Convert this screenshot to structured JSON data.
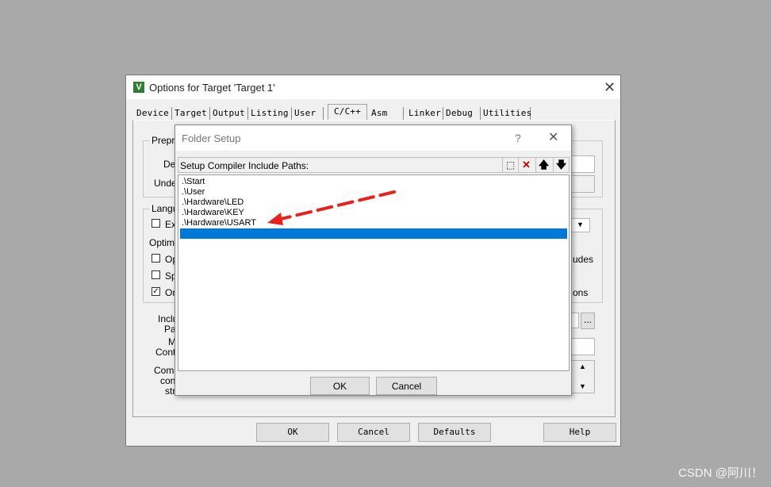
{
  "main_window": {
    "title": "Options for Target 'Target 1'",
    "close_glyph": "✕",
    "logo_glyph": "V",
    "tabs": [
      {
        "label": "Device"
      },
      {
        "label": "Target"
      },
      {
        "label": "Output"
      },
      {
        "label": "Listing"
      },
      {
        "label": "User"
      },
      {
        "label": "C/C++"
      },
      {
        "label": "Asm"
      },
      {
        "label": "Linker"
      },
      {
        "label": "Debug"
      },
      {
        "label": "Utilities"
      }
    ],
    "active_tab": "C/C++",
    "preprocessor_group_label": "Prepro",
    "define_label": "Def",
    "undefine_label": "Undef",
    "language_group_label": "Langu",
    "execute_label": "Ex",
    "optimization_label": "Optimiz",
    "opt1_label": "Op",
    "opt2_label": "Sp",
    "opt3_label": "On",
    "includes_label_right": "udes",
    "ons_label_right": "ons",
    "include_label_1": "Inclu",
    "include_label_2": "Pat",
    "misc_label_1": "M",
    "misc_label_2": "Contr",
    "compiler_label_1": "Comp",
    "compiler_label_2": "cont",
    "compiler_label_3": "stri",
    "browse_label": "...",
    "scroll_up_glyph": "▲",
    "scroll_down_glyph": "▼",
    "buttons": {
      "ok": "OK",
      "cancel": "Cancel",
      "defaults": "Defaults",
      "help": "Help"
    }
  },
  "folder_setup": {
    "title": "Folder Setup",
    "help_glyph": "?",
    "close_glyph": "✕",
    "header_label": "Setup Compiler Include Paths:",
    "toolbar": {
      "new_glyph": "⬚",
      "delete_glyph": "✕",
      "up_glyph": "🡅",
      "down_glyph": "🡇"
    },
    "paths": [
      ".\\Start",
      ".\\User",
      ".\\Hardware\\LED",
      ".\\Hardware\\KEY",
      ".\\Hardware\\USART",
      ""
    ],
    "selected_index": 5,
    "buttons": {
      "ok": "OK",
      "cancel": "Cancel"
    }
  },
  "annotation": {
    "arrow_color": "#e8221b"
  },
  "watermark": "CSDN @阿川！",
  "colors": {
    "selection": "#0078d7",
    "background": "#a9a9a9"
  }
}
